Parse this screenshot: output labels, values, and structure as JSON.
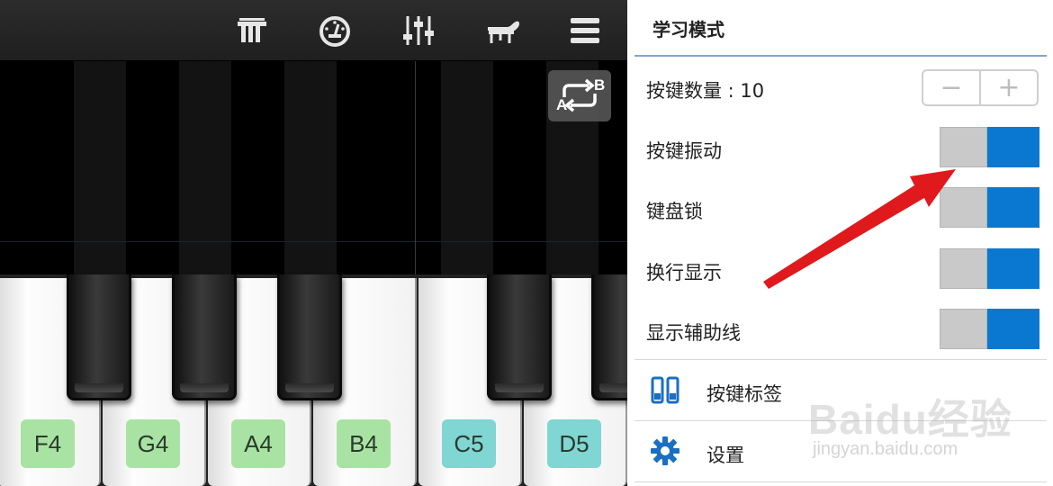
{
  "toolbar": {
    "icons": [
      "music-score-icon",
      "metronome-icon",
      "mixer-icon",
      "grand-piano-icon",
      "menu-icon"
    ]
  },
  "ab_button": {
    "a": "A",
    "b": "B"
  },
  "keyboard": {
    "white_keys": [
      {
        "label": "F4",
        "color": "#a8e3a3"
      },
      {
        "label": "G4",
        "color": "#a8e3a3"
      },
      {
        "label": "A4",
        "color": "#a8e3a3"
      },
      {
        "label": "B4",
        "color": "#a8e3a3"
      },
      {
        "label": "C5",
        "color": "#7fd6d2"
      },
      {
        "label": "D5",
        "color": "#7fd6d2"
      }
    ]
  },
  "panel": {
    "title": "学习模式",
    "key_count_label": "按键数量 : 10",
    "stepper": {
      "minus": "−",
      "plus": "+"
    },
    "toggles": [
      {
        "label": "按键振动",
        "state": "on"
      },
      {
        "label": "键盘锁",
        "state": "on"
      },
      {
        "label": "换行显示",
        "state": "on"
      },
      {
        "label": "显示辅助线",
        "state": "on"
      }
    ],
    "menu": [
      {
        "label": "按键标签",
        "icon": "key-labels-icon"
      },
      {
        "label": "设置",
        "icon": "gear-icon"
      }
    ]
  },
  "watermark": {
    "logo": "Baidu经验",
    "url": "jingyan.baidu.com"
  },
  "colors": {
    "accent": "#0a78d0",
    "toggle_off": "#c9c9c9",
    "arrow": "#e0191c"
  }
}
